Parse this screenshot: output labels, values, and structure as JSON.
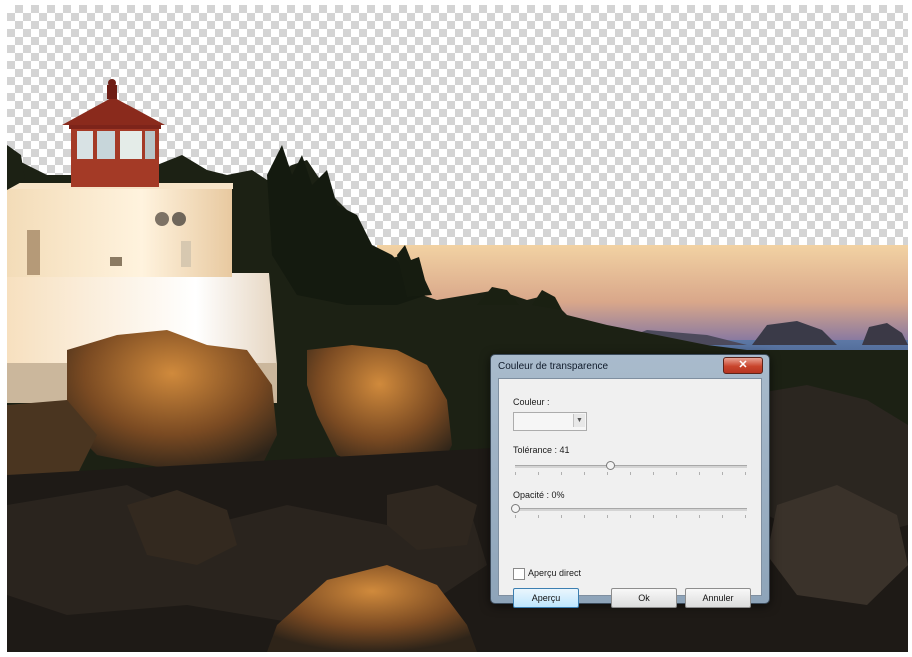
{
  "dialog": {
    "title": "Couleur de transparence",
    "close_glyph": "✕",
    "color_label": "Couleur :",
    "tolerance_label": "Tolérance : 41",
    "tolerance_value": 41,
    "opacity_label": "Opacité : 0%",
    "opacity_value": 0,
    "preview_checkbox_label": "Aperçu direct",
    "preview_checked": false,
    "buttons": {
      "preview": "Aperçu",
      "ok": "Ok",
      "cancel": "Annuler"
    }
  },
  "colors": {
    "checker_light": "#ffffff",
    "checker_dark": "#d4d4d4",
    "dialog_frame": "#9fb3c6",
    "close_button": "#c9452d"
  },
  "icons": {
    "close": "close-icon",
    "combo_arrow": "chevron-down-icon"
  }
}
